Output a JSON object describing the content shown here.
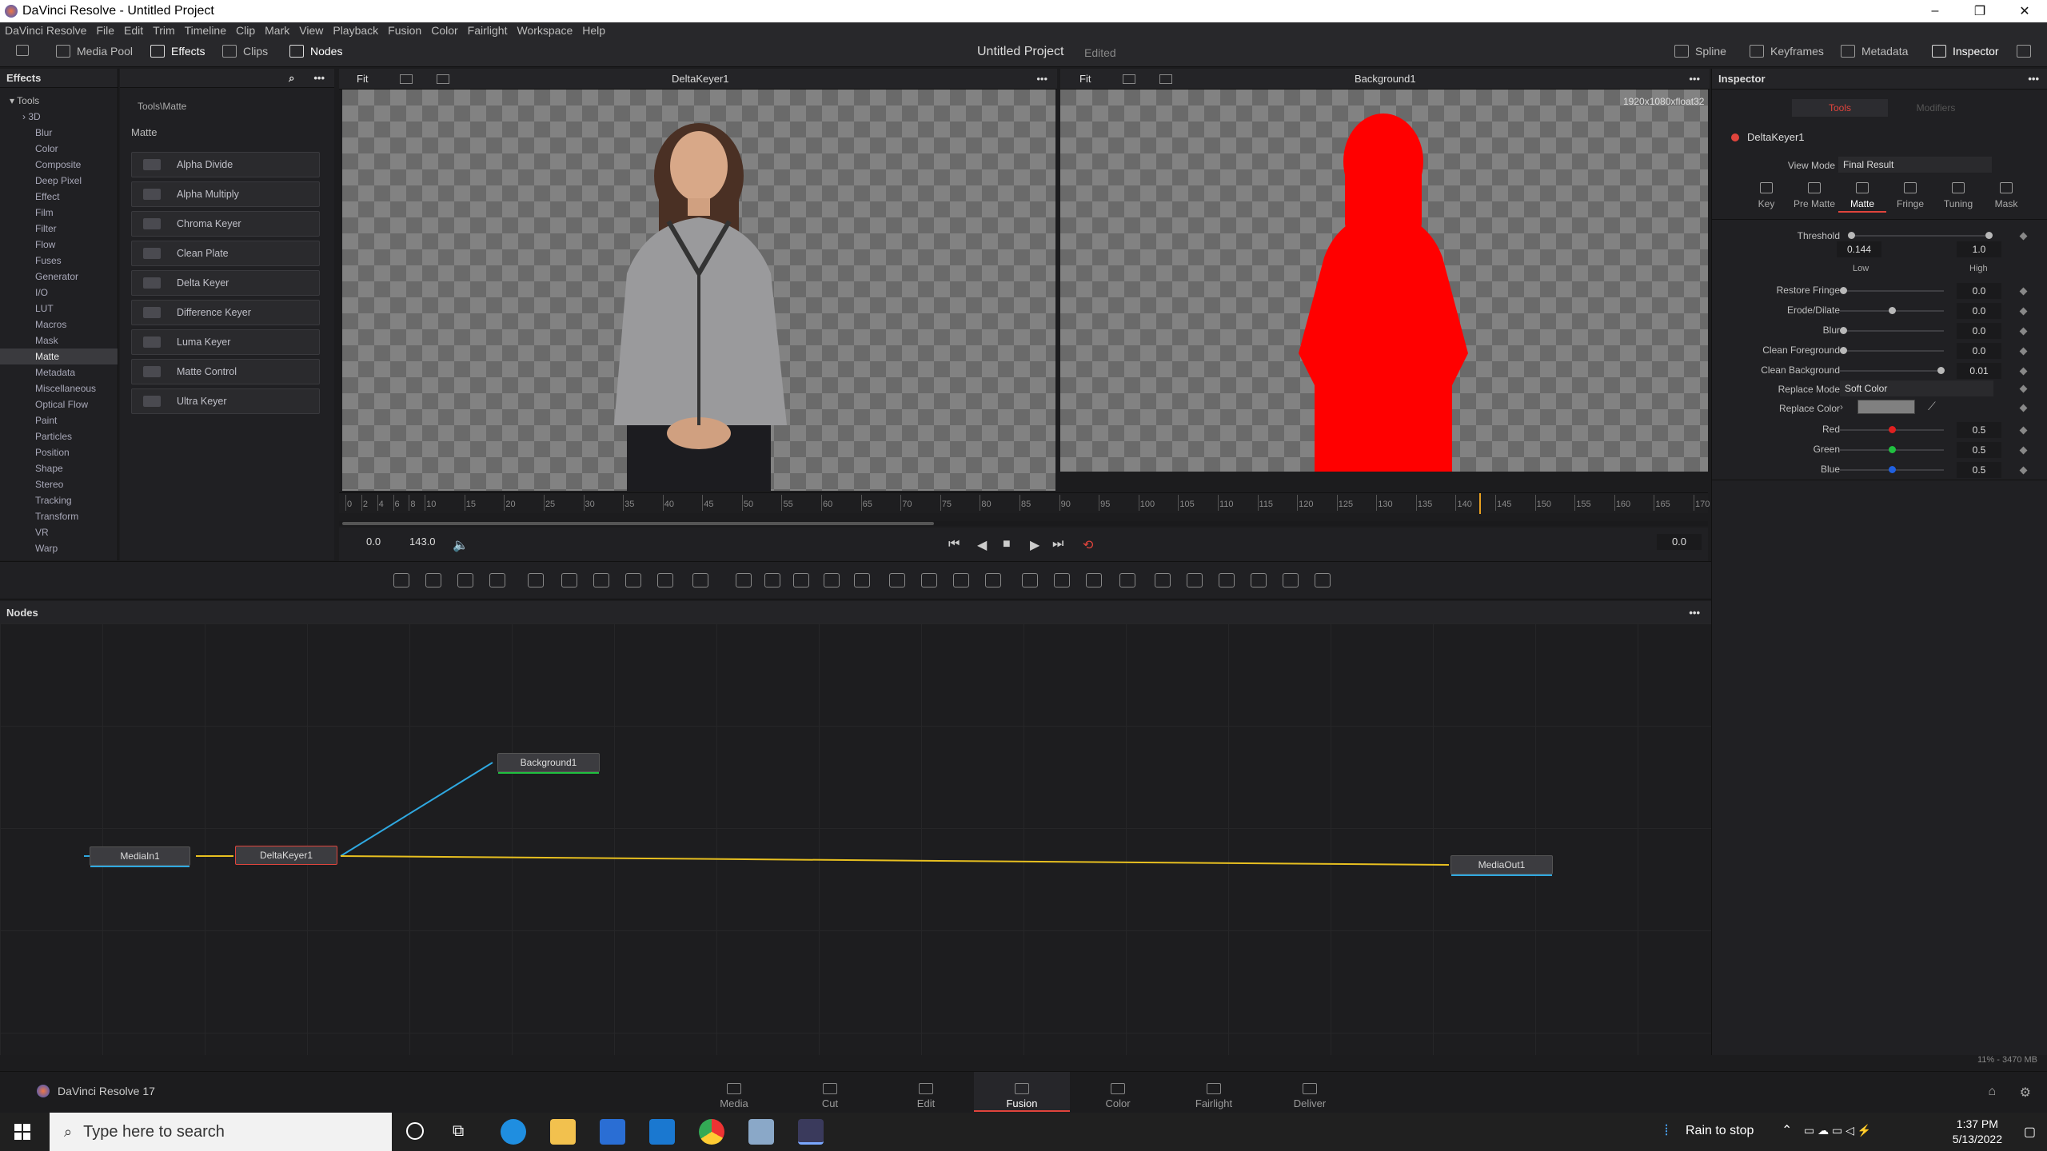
{
  "window": {
    "title": "DaVinci Resolve - Untitled Project",
    "min": "–",
    "max": "❐",
    "close": "✕"
  },
  "menu": [
    "DaVinci Resolve",
    "File",
    "Edit",
    "Trim",
    "Timeline",
    "Clip",
    "Mark",
    "View",
    "Playback",
    "Fusion",
    "Color",
    "Fairlight",
    "Workspace",
    "Help"
  ],
  "toolbar": {
    "media_pool": "Media Pool",
    "effects": "Effects",
    "clips": "Clips",
    "nodes": "Nodes",
    "project": "Untitled Project",
    "edited": "Edited",
    "spline": "Spline",
    "keyframes": "Keyframes",
    "metadata": "Metadata",
    "inspector": "Inspector"
  },
  "effects_panel": {
    "title": "Effects",
    "tree_root": "Tools",
    "tree": [
      "3D",
      "Blur",
      "Color",
      "Composite",
      "Deep Pixel",
      "Effect",
      "Film",
      "Filter",
      "Flow",
      "Fuses",
      "Generator",
      "I/O",
      "LUT",
      "Macros",
      "Mask",
      "Matte",
      "Metadata",
      "Miscellaneous",
      "Optical Flow",
      "Paint",
      "Particles",
      "Position",
      "Shape",
      "Stereo",
      "Tracking",
      "Transform",
      "VR",
      "Warp"
    ],
    "selected": "Matte"
  },
  "tools_panel": {
    "path": "Tools\\Matte",
    "category": "Matte",
    "tools": [
      "Alpha Divide",
      "Alpha Multiply",
      "Chroma Keyer",
      "Clean Plate",
      "Delta Keyer",
      "Difference Keyer",
      "Luma Keyer",
      "Matte Control",
      "Ultra Keyer"
    ]
  },
  "viewer_left": {
    "fit": "Fit",
    "name": "DeltaKeyer1"
  },
  "viewer_right": {
    "fit": "Fit",
    "name": "Background1",
    "resolution": "1920x1080xfloat32"
  },
  "ruler_ticks": [
    "0",
    "2",
    "4",
    "6",
    "8",
    "10",
    "15",
    "20",
    "25",
    "30",
    "35",
    "40",
    "45",
    "50",
    "55",
    "60",
    "65",
    "70",
    "75",
    "80",
    "85",
    "90",
    "95",
    "100",
    "105",
    "110",
    "115",
    "120",
    "125",
    "130",
    "135",
    "140",
    "145",
    "150",
    "155",
    "160",
    "165",
    "170"
  ],
  "playhead_frame": 143,
  "transport": {
    "start": "0.0",
    "end": "143.0",
    "current": "0.0"
  },
  "nodes": {
    "title": "Nodes",
    "items": {
      "media_in": "MediaIn1",
      "delta_keyer": "DeltaKeyer1",
      "background": "Background1",
      "media_out": "MediaOut1"
    }
  },
  "inspector": {
    "title": "Inspector",
    "tabs": {
      "tools": "Tools",
      "modifiers": "Modifiers"
    },
    "tool_name": "DeltaKeyer1",
    "view_mode_label": "View Mode",
    "view_mode": "Final Result",
    "subtabs": [
      "Key",
      "Pre Matte",
      "Matte",
      "Fringe",
      "Tuning",
      "Mask"
    ],
    "active_subtab": "Matte",
    "threshold": {
      "label": "Threshold",
      "low": "0.144",
      "high": "1.0",
      "low_label": "Low",
      "high_label": "High"
    },
    "props": [
      {
        "label": "Restore Fringe",
        "value": "0.0",
        "pos": 0.0
      },
      {
        "label": "Erode/Dilate",
        "value": "0.0",
        "pos": 0.5
      },
      {
        "label": "Blur",
        "value": "0.0",
        "pos": 0.0
      },
      {
        "label": "Clean Foreground",
        "value": "0.0",
        "pos": 0.0
      },
      {
        "label": "Clean Background",
        "value": "0.01",
        "pos": 1.0
      }
    ],
    "replace_mode_label": "Replace Mode",
    "replace_mode": "Soft Color",
    "replace_color_label": "Replace Color",
    "rgb": [
      {
        "label": "Red",
        "value": "0.5",
        "color": "#e02020"
      },
      {
        "label": "Green",
        "value": "0.5",
        "color": "#20c040"
      },
      {
        "label": "Blue",
        "value": "0.5",
        "color": "#2060e0"
      }
    ]
  },
  "status": "11% - 3470 MB",
  "pages": {
    "brand": "DaVinci Resolve 17",
    "items": [
      "Media",
      "Cut",
      "Edit",
      "Fusion",
      "Color",
      "Fairlight",
      "Deliver"
    ],
    "active": "Fusion"
  },
  "taskbar": {
    "search_placeholder": "Type here to search",
    "weather": "Rain to stop",
    "time": "1:37 PM",
    "date": "5/13/2022"
  },
  "colors": {
    "accent": "#e0443c",
    "matte_red": "#ff0000",
    "link_blue": "#2fa8e0",
    "link_yellow": "#e8c020"
  }
}
